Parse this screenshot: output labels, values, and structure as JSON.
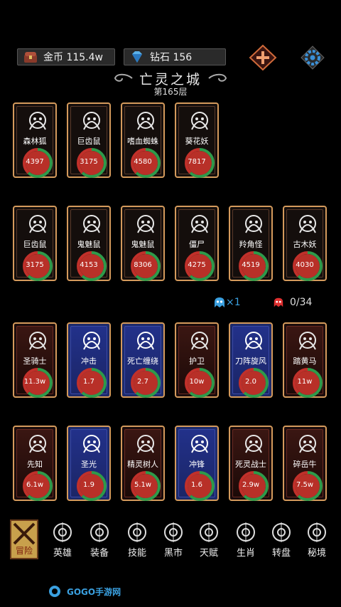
{
  "resources": {
    "gold_label": "金币 115.4w",
    "gem_label": "钻石 156"
  },
  "header": {
    "title": "亡灵之城",
    "floor": "第165层"
  },
  "enemies_row1": [
    {
      "name": "森林狐",
      "value": "4397",
      "icon": "fox-icon"
    },
    {
      "name": "巨齿鼠",
      "value": "3175",
      "icon": "rat-icon"
    },
    {
      "name": "嗜血蜘蛛",
      "value": "4580",
      "icon": "spider-icon"
    },
    {
      "name": "葵花妖",
      "value": "7817",
      "icon": "flower-icon"
    }
  ],
  "enemies_row2": [
    {
      "name": "巨齿鼠",
      "value": "3175",
      "icon": "rat-icon"
    },
    {
      "name": "鬼魅鼠",
      "value": "4153",
      "icon": "ghost-rat-icon"
    },
    {
      "name": "鬼魅鼠",
      "value": "8306",
      "icon": "ghost-rat-icon"
    },
    {
      "name": "僵尸",
      "value": "4275",
      "icon": "mummy-icon"
    },
    {
      "name": "羚角怪",
      "value": "4519",
      "icon": "antelope-icon"
    },
    {
      "name": "古木妖",
      "value": "4030",
      "icon": "tree-icon"
    }
  ],
  "counters": {
    "multiplier": "×1",
    "kills": "0/34"
  },
  "heroes_row1": [
    {
      "name": "圣骑士",
      "value": "11.3w",
      "style": "dark",
      "icon": "paladin-icon"
    },
    {
      "name": "冲击",
      "value": "1.7",
      "style": "blue",
      "icon": "impact-icon"
    },
    {
      "name": "死亡缠绕",
      "value": "2.7",
      "style": "blue",
      "icon": "death-coil-icon"
    },
    {
      "name": "护卫",
      "value": "10w",
      "style": "dark",
      "icon": "guard-icon"
    },
    {
      "name": "刀阵旋风",
      "value": "2.0",
      "style": "blue",
      "icon": "blade-storm-icon"
    },
    {
      "name": "踏黄马",
      "value": "11w",
      "style": "dark",
      "icon": "horse-icon"
    }
  ],
  "heroes_row2": [
    {
      "name": "先知",
      "value": "6.1w",
      "style": "dark",
      "icon": "prophet-icon"
    },
    {
      "name": "圣光",
      "value": "1.9",
      "style": "blue",
      "icon": "holy-light-icon"
    },
    {
      "name": "精灵树人",
      "value": "5.1w",
      "style": "dark",
      "icon": "treant-icon"
    },
    {
      "name": "冲锋",
      "value": "1.6",
      "style": "blue",
      "icon": "charge-icon"
    },
    {
      "name": "死灵战士",
      "value": "2.9w",
      "style": "dark",
      "icon": "undead-warrior-icon"
    },
    {
      "name": "碎岳牛",
      "value": "7.5w",
      "style": "dark",
      "icon": "bull-icon"
    }
  ],
  "nav": [
    {
      "label": "冒险",
      "icon": "crossed-swords-icon"
    },
    {
      "label": "英雄",
      "icon": "hero-icon"
    },
    {
      "label": "装备",
      "icon": "shield-icon"
    },
    {
      "label": "技能",
      "icon": "skill-icon"
    },
    {
      "label": "黑市",
      "icon": "scales-icon"
    },
    {
      "label": "天赋",
      "icon": "tree-talent-icon"
    },
    {
      "label": "生肖",
      "icon": "zodiac-icon"
    },
    {
      "label": "转盘",
      "icon": "wheel-icon"
    },
    {
      "label": "秘境",
      "icon": "portal-icon"
    }
  ],
  "watermark": "GOGO手游网",
  "colors": {
    "card_border": "#d49a5c",
    "ring_green": "#2e9a4a",
    "ring_red": "#c0302a",
    "hero_blue": "#1c2a6a",
    "counter_blue": "#3aa0e0",
    "counter_red": "#e03030"
  }
}
